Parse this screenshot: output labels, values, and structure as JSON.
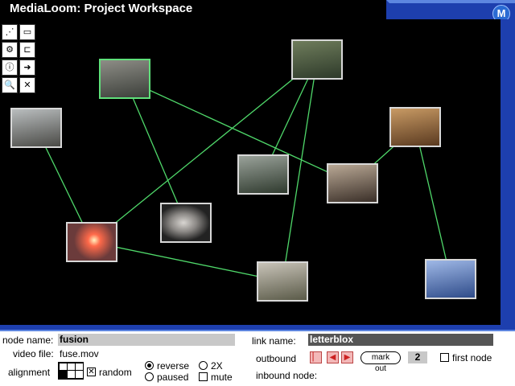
{
  "app": {
    "title": "MediaLoom: Project Workspace",
    "logo_text": "M"
  },
  "tools": [
    {
      "name": "select-node-tool",
      "glyph": "⋰"
    },
    {
      "name": "window-tool",
      "glyph": "▭"
    },
    {
      "name": "link-tool",
      "glyph": "⚙"
    },
    {
      "name": "connect-tool",
      "glyph": "⊏"
    },
    {
      "name": "info-tool",
      "glyph": "ⓘ"
    },
    {
      "name": "export-tool",
      "glyph": "➜"
    },
    {
      "name": "inspect-tool",
      "glyph": "🔍"
    },
    {
      "name": "delete-tool",
      "glyph": "✕"
    }
  ],
  "nodes": [
    {
      "id": "sunset-road",
      "color_a": "#8d8d86",
      "color_b": "#3c3f3a"
    },
    {
      "id": "circuit-board",
      "color_a": "#6f7d5c",
      "color_b": "#2e3a2a"
    },
    {
      "id": "railway-tracks",
      "color_a": "#b9bdbe",
      "color_b": "#4a4a46"
    },
    {
      "id": "bar-drinks",
      "color_a": "#c89a64",
      "color_b": "#5a3a20"
    },
    {
      "id": "waterfall",
      "color_a": "#9aa29a",
      "color_b": "#2f3a2e"
    },
    {
      "id": "child-portrait",
      "color_a": "#b9a895",
      "color_b": "#3a2f28"
    },
    {
      "id": "face-closeup",
      "color_a": "#d9d6d2",
      "color_b": "#222"
    },
    {
      "id": "fusion",
      "color_a": "#ff6a4a",
      "color_b": "#6b3b3b"
    },
    {
      "id": "runner-field",
      "color_a": "#c8c3b8",
      "color_b": "#5a5a48"
    },
    {
      "id": "letterblox",
      "color_a": "#9fb8e6",
      "color_b": "#2f4c8a"
    }
  ],
  "links": [
    [
      "sunset-road",
      "child-portrait"
    ],
    [
      "sunset-road",
      "face-closeup"
    ],
    [
      "circuit-board",
      "fusion"
    ],
    [
      "circuit-board",
      "waterfall"
    ],
    [
      "circuit-board",
      "runner-field"
    ],
    [
      "railway-tracks",
      "fusion"
    ],
    [
      "bar-drinks",
      "child-portrait"
    ],
    [
      "bar-drinks",
      "letterblox"
    ],
    [
      "fusion",
      "runner-field"
    ]
  ],
  "selected_node": "sunset-road",
  "panel": {
    "node_name_label": "node name:",
    "node_name_value": "fusion",
    "video_file_label": "video file:",
    "video_file_value": "fuse.mov",
    "alignment_label": "alignment",
    "random_label": "random",
    "random_checked": true,
    "reverse_label": "reverse",
    "paused_label": "paused",
    "twox_label": "2X",
    "mute_label": "mute",
    "playback_mode": "reverse",
    "link_name_label": "link name:",
    "link_name_value": "letterblox",
    "outbound_label": "outbound",
    "mark_out_label": "mark out",
    "outbound_count": "2",
    "first_node_label": "first node",
    "inbound_label": "inbound node:"
  },
  "colors": {
    "frame_blue": "#1d3fae",
    "link_green": "#4fd86a",
    "canvas": "#000000"
  }
}
